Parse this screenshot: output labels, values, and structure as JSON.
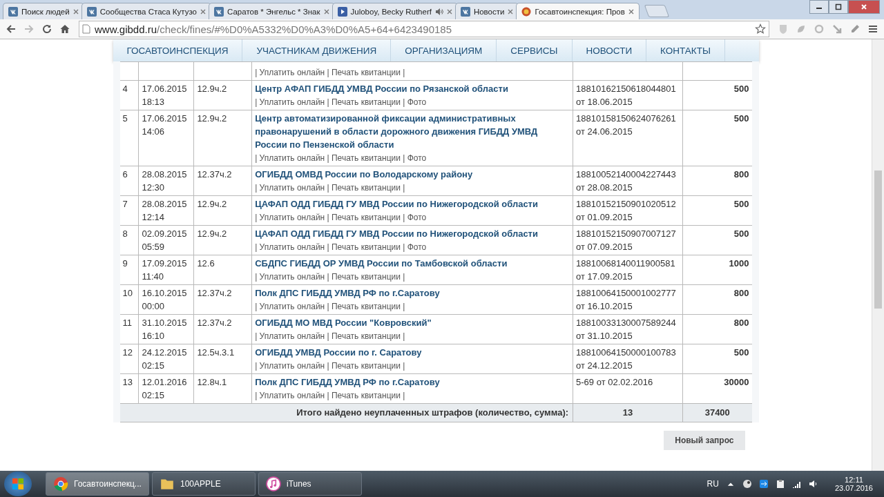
{
  "browser": {
    "tabs": [
      {
        "title": "Поиск людей",
        "kind": "vk",
        "audio": false,
        "selected": false
      },
      {
        "title": "Сообщества Стаса Кутузо",
        "kind": "vk",
        "audio": false,
        "selected": false
      },
      {
        "title": "Саратов * Энгельс * Знак",
        "kind": "vk",
        "audio": false,
        "selected": false
      },
      {
        "title": "Juloboy, Becky Rutherf",
        "kind": "play",
        "audio": true,
        "selected": false
      },
      {
        "title": "Новости",
        "kind": "vk",
        "audio": false,
        "selected": false
      },
      {
        "title": "Госавтоинспекция: Пров",
        "kind": "emblem",
        "audio": false,
        "selected": true
      }
    ],
    "url_host": "www.gibdd.ru",
    "url_path": "/check/fines/#%D0%A5332%D0%A3%D0%A5+64+6423490185"
  },
  "nav": [
    "ГОСАВТОИНСПЕКЦИЯ",
    "УЧАСТНИКАМ ДВИЖЕНИЯ",
    "ОРГАНИЗАЦИЯМ",
    "СЕРВИСЫ",
    "НОВОСТИ",
    "КОНТАКТЫ"
  ],
  "partial_row": {
    "actions": "| Уплатить онлайн  | Печать квитанции |"
  },
  "rows": [
    {
      "num": "4",
      "date": "17.06.2015",
      "time": "18:13",
      "article": "12.9ч.2",
      "org": "Центр АФАП ГИБДД УМВД России по Рязанской области",
      "actions": "| Уплатить онлайн  | Печать квитанции | Фото",
      "decree": "18810162150618044801",
      "decree_date": "от 18.06.2015",
      "amount": "500"
    },
    {
      "num": "5",
      "date": "17.06.2015",
      "time": "14:06",
      "article": "12.9ч.2",
      "org": "Центр автоматизированной фиксации административных правонарушений в области дорожного движения ГИБДД УМВД России по Пензенской области",
      "actions": "| Уплатить онлайн  | Печать квитанции | Фото",
      "decree": "18810158150624076261",
      "decree_date": "от 24.06.2015",
      "amount": "500"
    },
    {
      "num": "6",
      "date": "28.08.2015",
      "time": "12:30",
      "article": "12.37ч.2",
      "org": "ОГИБДД ОМВД России по Володарскому району",
      "actions": "| Уплатить онлайн  | Печать квитанции |",
      "decree": "18810052140004227443",
      "decree_date": "от 28.08.2015",
      "amount": "800"
    },
    {
      "num": "7",
      "date": "28.08.2015",
      "time": "12:14",
      "article": "12.9ч.2",
      "org": "ЦАФАП ОДД ГИБДД ГУ МВД России по Нижегородской области",
      "actions": "| Уплатить онлайн  | Печать квитанции | Фото",
      "decree": "18810152150901020512",
      "decree_date": "от 01.09.2015",
      "amount": "500"
    },
    {
      "num": "8",
      "date": "02.09.2015",
      "time": "05:59",
      "article": "12.9ч.2",
      "org": "ЦАФАП ОДД ГИБДД ГУ МВД России по Нижегородской области",
      "actions": "| Уплатить онлайн  | Печать квитанции | Фото",
      "decree": "18810152150907007127",
      "decree_date": "от 07.09.2015",
      "amount": "500"
    },
    {
      "num": "9",
      "date": "17.09.2015",
      "time": "11:40",
      "article": "12.6",
      "org": "СБДПС ГИБДД ОР УМВД России по Тамбовской области",
      "actions": "| Уплатить онлайн  | Печать квитанции |",
      "decree": "18810068140011900581",
      "decree_date": "от 17.09.2015",
      "amount": "1000"
    },
    {
      "num": "10",
      "date": "16.10.2015",
      "time": "00:00",
      "article": "12.37ч.2",
      "org": "Полк ДПС ГИБДД УМВД РФ по г.Саратову",
      "actions": "| Уплатить онлайн  | Печать квитанции |",
      "decree": "18810064150001002777",
      "decree_date": "от 16.10.2015",
      "amount": "800"
    },
    {
      "num": "11",
      "date": "31.10.2015",
      "time": "16:10",
      "article": "12.37ч.2",
      "org": "ОГИБДД МО МВД России \"Ковровский\"",
      "actions": "| Уплатить онлайн  | Печать квитанции |",
      "decree": "18810033130007589244",
      "decree_date": "от 31.10.2015",
      "amount": "800"
    },
    {
      "num": "12",
      "date": "24.12.2015",
      "time": "02:15",
      "article": "12.5ч.3.1",
      "org": "ОГИБДД УМВД России по г. Саратову",
      "actions": "| Уплатить онлайн  | Печать квитанции |",
      "decree": "18810064150000100783",
      "decree_date": "от 24.12.2015",
      "amount": "500"
    },
    {
      "num": "13",
      "date": "12.01.2016",
      "time": "02:15",
      "article": "12.8ч.1",
      "org": "Полк ДПС ГИБДД УМВД РФ по г.Саратову",
      "actions": "| Уплатить онлайн  | Печать квитанции |",
      "decree": "5-69 от 02.02.2016",
      "amount": "30000"
    }
  ],
  "total": {
    "label": "Итого найдено неуплаченных штрафов (количество, сумма):",
    "count": "13",
    "sum": "37400"
  },
  "new_request": "Новый запрос",
  "taskbar": {
    "items": [
      {
        "label": "Госавтоинспекц...",
        "kind": "chrome",
        "selected": true
      },
      {
        "label": "100APPLE",
        "kind": "folder",
        "selected": false
      },
      {
        "label": "iTunes",
        "kind": "music",
        "selected": false
      }
    ],
    "language": "RU",
    "time": "12:11",
    "date": "23.07.2016"
  }
}
